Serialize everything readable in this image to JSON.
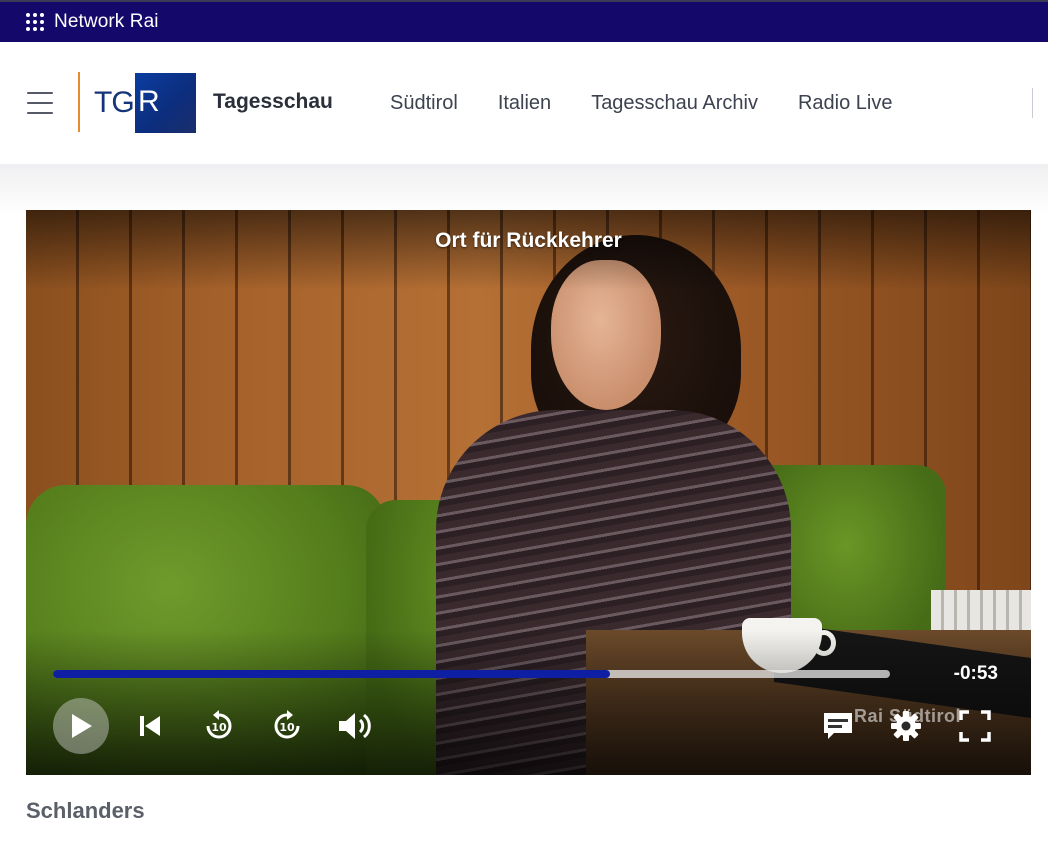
{
  "network_bar": {
    "label": "Network Rai",
    "bg_color": "#14086a"
  },
  "header": {
    "logo": {
      "text_left": "TG",
      "text_right": "R",
      "accent_color": "#e98a2e",
      "box_color": "#0d2d7c"
    },
    "brand": "Tagesschau",
    "nav": [
      {
        "label": "Südtirol"
      },
      {
        "label": "Italien"
      },
      {
        "label": "Tagesschau Archiv"
      },
      {
        "label": "Radio Live"
      }
    ]
  },
  "player": {
    "title": "Ort für Rückkehrer",
    "progress_fraction": 0.665,
    "progress_color": "#0f1fa3",
    "time_remaining": "-0:53",
    "watermark": "Rai Südtirol",
    "controls": {
      "play": "play-icon",
      "previous": "skip-previous-icon",
      "rewind": "replay-10-icon",
      "forward": "forward-10-icon",
      "volume": "volume-icon",
      "subtitles": "subtitles-icon",
      "settings": "gear-icon",
      "fullscreen": "fullscreen-icon"
    }
  },
  "location": "Schlanders"
}
